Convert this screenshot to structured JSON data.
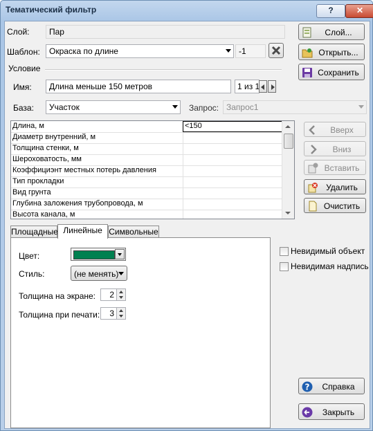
{
  "window": {
    "title": "Тематический фильтр",
    "help_glyph": "?",
    "close_glyph": "✕"
  },
  "layer": {
    "label": "Слой:",
    "value": "Пар",
    "button": "Слой..."
  },
  "template": {
    "label": "Шаблон:",
    "value": "Окраска по длине",
    "index": "-1",
    "open_button": "Открыть...",
    "save_button": "Сохранить"
  },
  "condition": {
    "group_label": "Условие",
    "name_label": "Имя:",
    "name_value": "Длина меньше 150 метров",
    "counter": "1 из 1",
    "base_label": "База:",
    "base_value": "Участок",
    "query_label": "Запрос:",
    "query_value": "Запрос1"
  },
  "fields": [
    {
      "name": "Длина, м",
      "value": "<150"
    },
    {
      "name": "Диаметр внутренний, м",
      "value": ""
    },
    {
      "name": "Толщина стенки, м",
      "value": ""
    },
    {
      "name": "Шероховатость, мм",
      "value": ""
    },
    {
      "name": "Коэффициэнт местных потерь давления",
      "value": ""
    },
    {
      "name": "Тип прокладки",
      "value": ""
    },
    {
      "name": "Вид грунта",
      "value": ""
    },
    {
      "name": "Глубина заложения трубопровода, м",
      "value": ""
    },
    {
      "name": "Высота канала, м",
      "value": ""
    }
  ],
  "side_buttons": {
    "up": "Вверх",
    "down": "Вниз",
    "insert": "Вставить",
    "delete": "Удалить",
    "clear": "Очистить"
  },
  "tabs": [
    "Площадные",
    "Линейные",
    "Символьные"
  ],
  "active_tab": "Линейные",
  "linear": {
    "color_label": "Цвет:",
    "color": "#008050",
    "style_label": "Стиль:",
    "style_value": "(не менять)",
    "screen_width_label": "Толщина на экране:",
    "screen_width": "2",
    "print_width_label": "Толщина при печати:",
    "print_width": "3"
  },
  "options": {
    "invisible_object": "Невидимый объект",
    "invisible_label": "Невидимая надпись"
  },
  "footer": {
    "help_button": "Справка",
    "close_button": "Закрыть"
  }
}
